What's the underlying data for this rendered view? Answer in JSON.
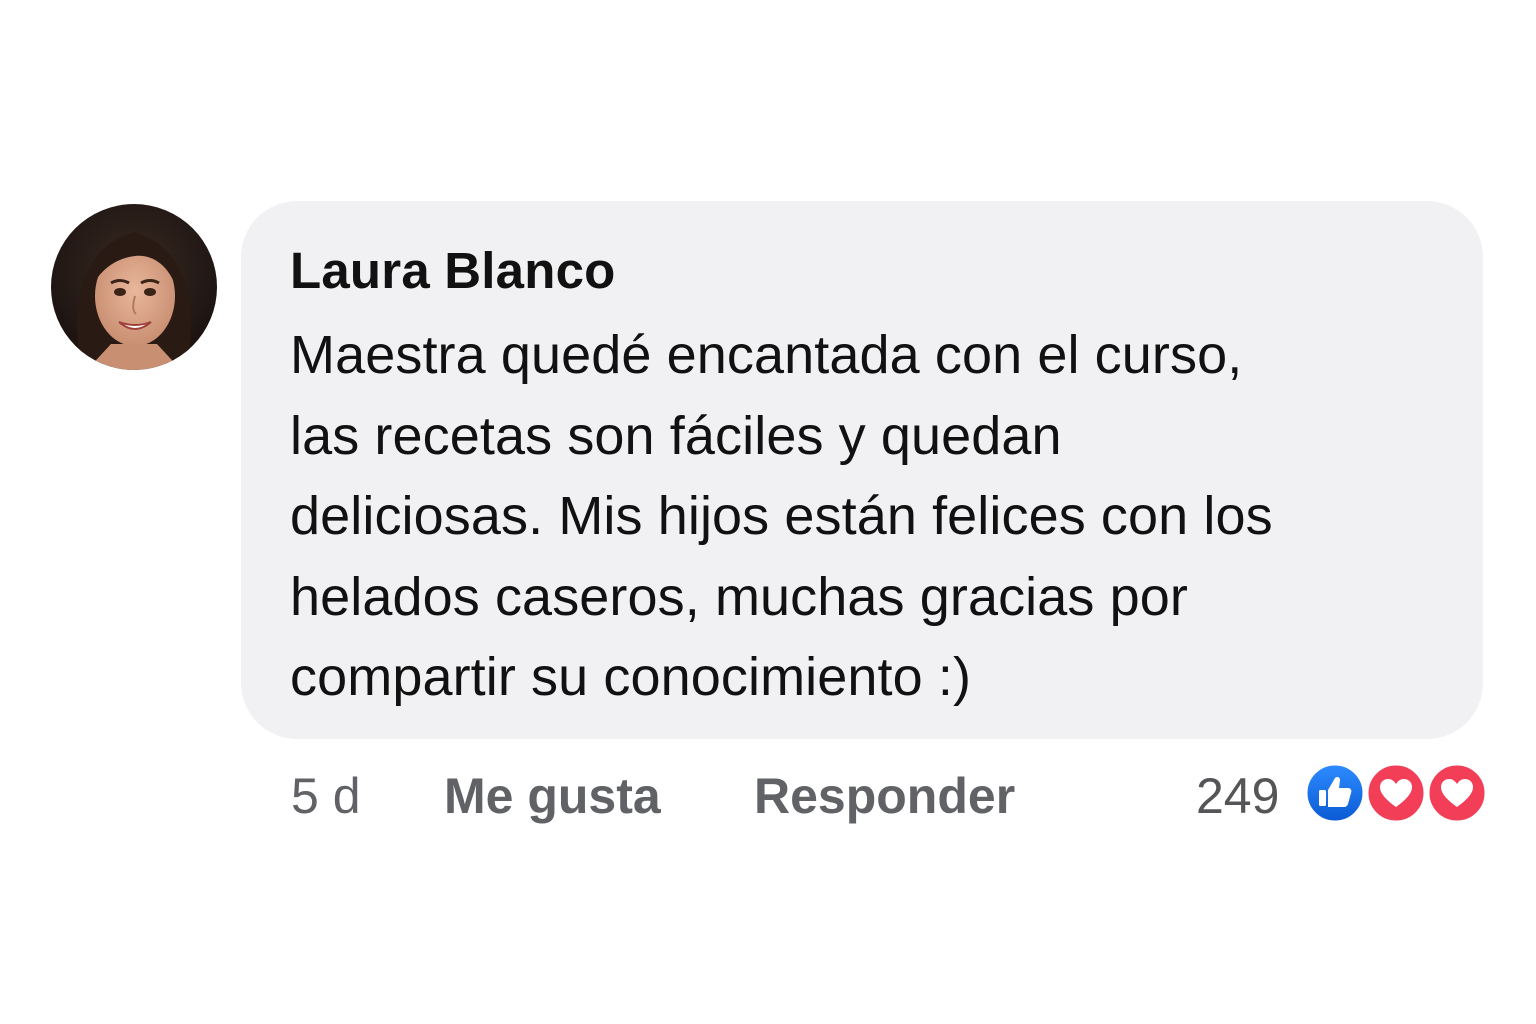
{
  "comment": {
    "author": "Laura Blanco",
    "text": "Maestra quedé encantada con el curso,\nlas recetas son fáciles y quedan\ndeliciosas. Mis hijos están felices con los\nhelados caseros, muchas gracias por\ncompartir su conocimiento :)",
    "timestamp": "5 d",
    "like_label": "Me gusta",
    "reply_label": "Responder",
    "reaction_count": "249",
    "reactions": [
      "like-icon",
      "love-icon",
      "love-icon"
    ]
  },
  "colors": {
    "bubble_background": "#f1f1f3",
    "author_text": "#111111",
    "action_text": "#606266",
    "like_blue": "#1877f2",
    "love_red": "#f33e58"
  }
}
